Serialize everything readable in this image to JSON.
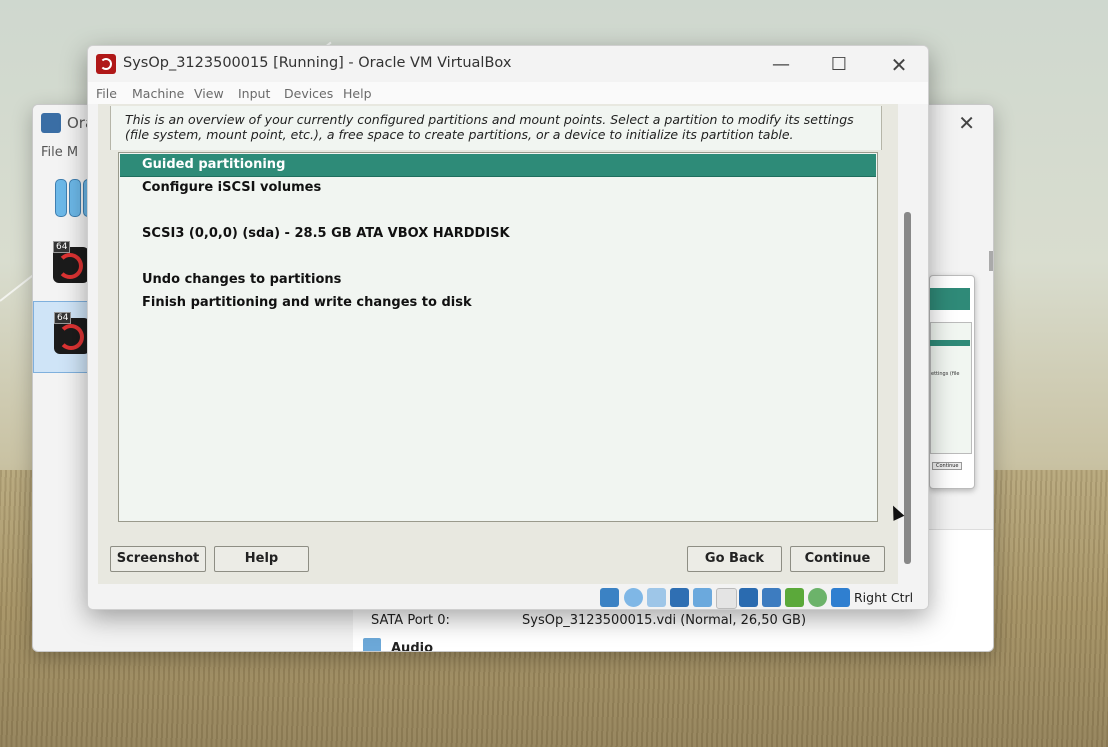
{
  "background_manager": {
    "title": "Ora",
    "menu": "File  M",
    "vm_badge": "64",
    "sata_label": "SATA Port 0:",
    "sata_value": "SysOp_3123500015.vdi (Normal, 26,50 GB)",
    "audio_label": "Audio",
    "preview_text": "ettings (file",
    "preview_button": "Continue"
  },
  "vm_window": {
    "title": "SysOp_3123500015 [Running] - Oracle VM VirtualBox",
    "menu": [
      "File",
      "Machine",
      "View",
      "Input",
      "Devices",
      "Help"
    ],
    "host_key": "Right Ctrl"
  },
  "installer": {
    "description": "This is an overview of your currently configured partitions and mount points. Select a partition to modify its settings (file system, mount point, etc.), a free space to create partitions, or a device to initialize its partition table.",
    "items": [
      {
        "label": "Guided partitioning",
        "selected": true
      },
      {
        "label": "Configure iSCSI volumes",
        "selected": false
      },
      {
        "label": "SCSI3 (0,0,0) (sda) - 28.5 GB ATA VBOX HARDDISK",
        "selected": false
      },
      {
        "label": "Undo changes to partitions",
        "selected": false
      },
      {
        "label": "Finish partitioning and write changes to disk",
        "selected": false
      }
    ],
    "buttons": {
      "screenshot": "Screenshot",
      "help": "Help",
      "go_back": "Go Back",
      "continue": "Continue"
    }
  },
  "colors": {
    "selection": "#2e8b78",
    "list_bg": "#f1f5f1"
  },
  "status_icons": [
    "hard-disk-icon",
    "optical-disk-icon",
    "audio-icon",
    "network-icon",
    "usb-icon",
    "shared-folders-icon",
    "display-icon",
    "recording-icon",
    "mouse-integration-icon",
    "keyboard-icon",
    "host-key-arrow-icon"
  ]
}
